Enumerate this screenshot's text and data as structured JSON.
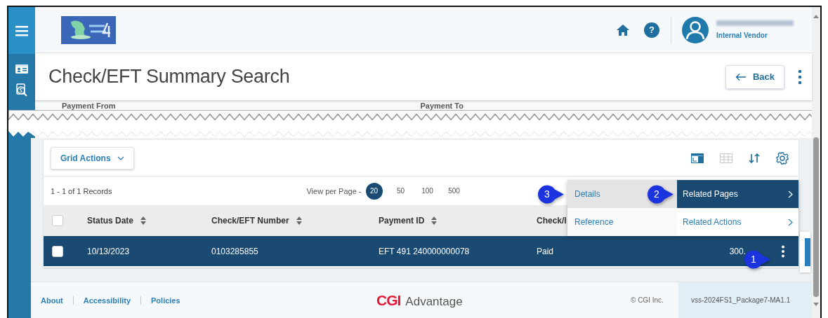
{
  "header": {
    "help_glyph": "?",
    "user_role": "Internal Vendor"
  },
  "page": {
    "title": "Check/EFT Summary Search",
    "back_button": "Back"
  },
  "search_fields": [
    {
      "label": "Payment From"
    },
    {
      "label": "Payment To"
    }
  ],
  "grid": {
    "actions_button": "Grid Actions",
    "views": [
      {
        "kind": "card",
        "selected": true
      },
      {
        "kind": "table",
        "selected": false
      }
    ],
    "record_count": "1 - 1 of 1 Records",
    "page_size_label": "View per Page -",
    "page_sizes": [
      {
        "label": "20",
        "selected": true
      },
      {
        "label": "50",
        "selected": false
      },
      {
        "label": "100",
        "selected": false
      },
      {
        "label": "500",
        "selected": false
      }
    ],
    "select_all_checked": false,
    "columns": [
      {
        "label": "Status Date",
        "sortable": true
      },
      {
        "label": "Check/EFT Number",
        "sortable": true
      },
      {
        "label": "Payment ID",
        "sortable": true
      },
      {
        "label": "Check/I",
        "sortable": false
      }
    ],
    "rows": [
      {
        "selected": true,
        "checked": false,
        "cells": [
          "10/13/2023",
          "0103285855",
          "EFT 491 240000000078",
          "Paid",
          "300."
        ],
        "actions_callout": "1"
      }
    ]
  },
  "context_menu": {
    "items": [
      {
        "label": "Details",
        "selected": true,
        "callout": "3"
      },
      {
        "label": "Reference",
        "selected": false
      }
    ],
    "submenus": [
      {
        "label": "Related Pages",
        "selected": true,
        "callout": "2"
      },
      {
        "label": "Related Actions",
        "selected": false
      }
    ]
  },
  "footer": {
    "links": [
      "About",
      "Accessibility",
      "Policies"
    ],
    "brand_mark": "CGI",
    "brand_name": "Advantage",
    "copyright": "© CGI Inc.",
    "version": "vss-2024FS1_Package7-MA1.1"
  }
}
